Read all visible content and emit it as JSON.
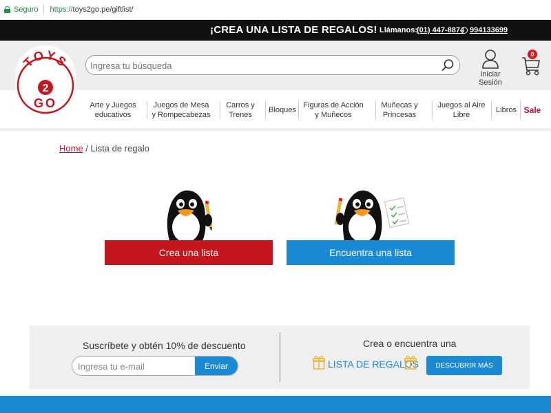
{
  "browser": {
    "secure_label": "Seguro",
    "url_protocol": "https://",
    "url_rest": "toys2go.pe/giftlist/"
  },
  "promo": {
    "headline": "¡CREA UNA LISTA DE REGALOS!",
    "call_label": "Llámanos:",
    "phone": "(01) 447-8874",
    "whatsapp": "994133699"
  },
  "logo": {
    "line1": "TOYS",
    "line2": "2",
    "line3": "GO"
  },
  "search": {
    "placeholder": "Ingresa tu búsqueda"
  },
  "account": {
    "login_label": "Iniciar Sesión"
  },
  "cart": {
    "count": "0"
  },
  "nav": {
    "items": [
      {
        "label": "Arte y Juegos educativos"
      },
      {
        "label": "Juegos de Mesa y Rompecabezas"
      },
      {
        "label": "Carros y Trenes"
      },
      {
        "label": "Bloques"
      },
      {
        "label": "Figuras de Acción y Muñecos"
      },
      {
        "label": "Muñecas y Princesas"
      },
      {
        "label": "Juegos al Aire Libre"
      },
      {
        "label": "Libros"
      },
      {
        "label": "Sale"
      }
    ]
  },
  "breadcrumb": {
    "home": "Home",
    "separator": " / ",
    "current": "Lista de regalo"
  },
  "actions": {
    "create_label": "Crea una lista",
    "find_label": "Encuentra una lista"
  },
  "subscribe": {
    "title": "Suscríbete y obtén 10% de descuento",
    "email_placeholder": "Ingresa tu e-mail",
    "send_label": "Enviar"
  },
  "giftlist_promo": {
    "title": "Crea o encuentra una",
    "link_label": "LISTA DE REGALOS",
    "discover_label": "DESCUBRIR MÁS"
  },
  "colors": {
    "brand_red": "#c4161c",
    "brand_blue": "#1a8ad4",
    "gold": "#e8b53a"
  }
}
